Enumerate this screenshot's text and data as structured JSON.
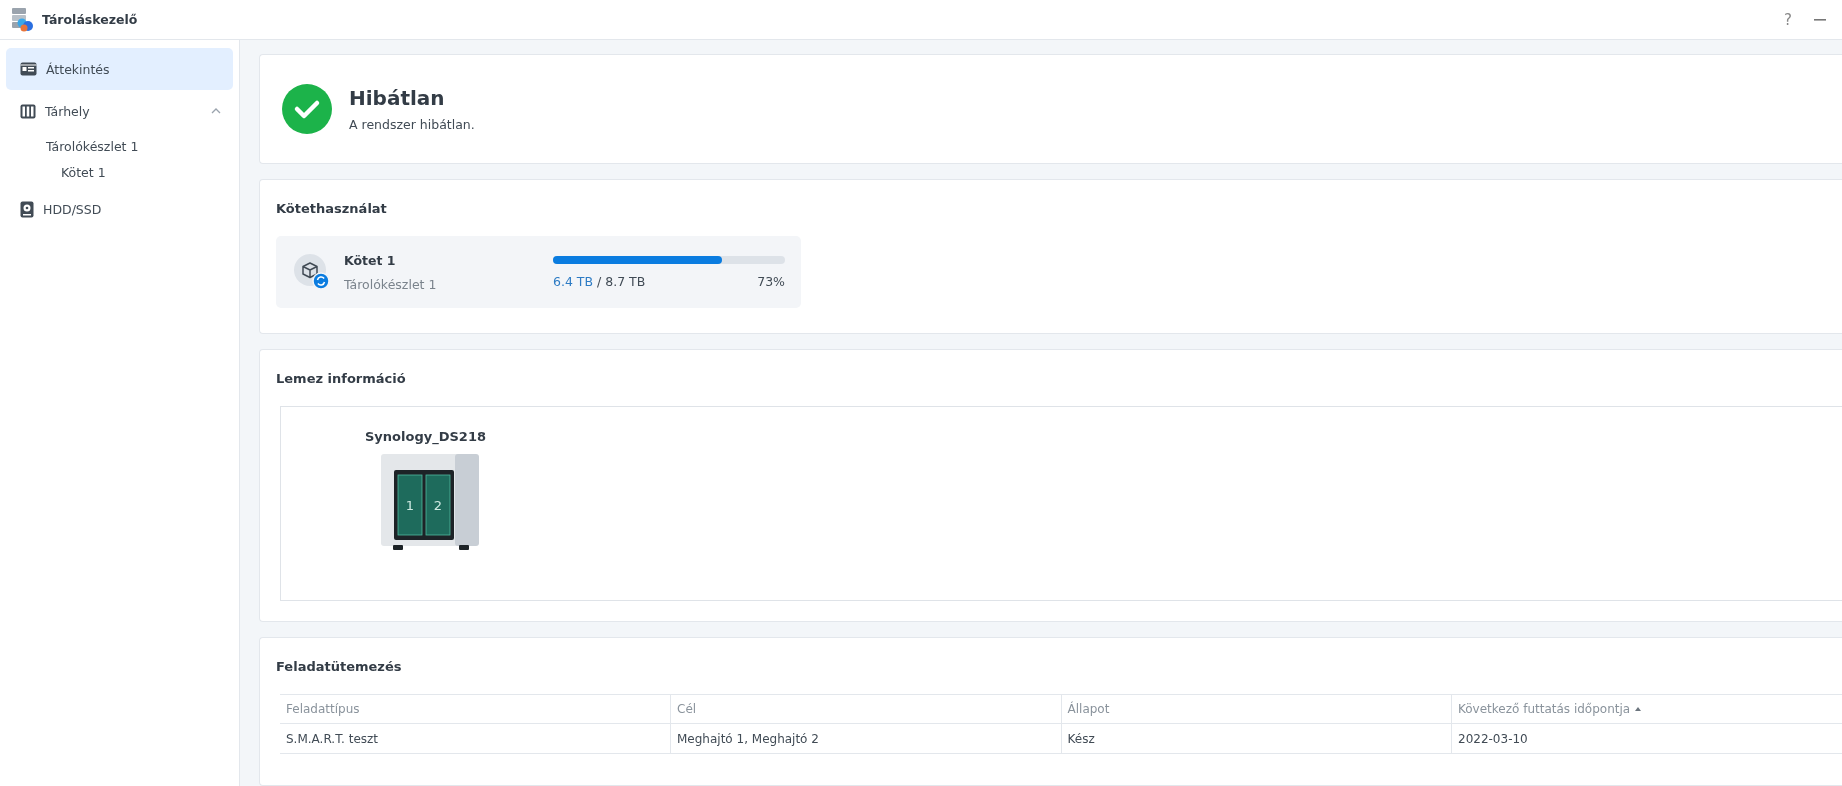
{
  "window": {
    "title": "Tároláskezelő",
    "help_label": "?"
  },
  "sidebar": {
    "items": [
      {
        "kind": "overview",
        "label": "Áttekintés",
        "selected": true
      },
      {
        "kind": "storage",
        "label": "Tárhely",
        "selected": false,
        "expanded": true,
        "children": [
          {
            "label": "Tárolókészlet 1",
            "selected": false,
            "children": [
              {
                "label": "Kötet 1",
                "selected": false
              }
            ]
          }
        ]
      },
      {
        "kind": "disk",
        "label": "HDD/SSD",
        "selected": false
      }
    ]
  },
  "status": {
    "kind": "healthy",
    "title": "Hibátlan",
    "message": "A rendszer hibátlan."
  },
  "volume_usage": {
    "title": "Kötethasználat",
    "volumes": [
      {
        "name": "Kötet 1",
        "pool": "Tárolókészlet 1",
        "used": "6.4 TB",
        "total": "/ 8.7 TB",
        "percent": "73%",
        "level": 0.73
      }
    ]
  },
  "disk_info": {
    "title": "Lemez információ",
    "device": {
      "name": "Synology_DS218",
      "bays": [
        {
          "label": "1"
        },
        {
          "label": "2"
        }
      ]
    }
  },
  "task_schedule": {
    "title": "Feladatütemezés",
    "table": {
      "columns": [
        {
          "label": "Feladattípus",
          "sorted": false
        },
        {
          "label": "Cél",
          "sorted": false
        },
        {
          "label": "Állapot",
          "sorted": false
        },
        {
          "label": "Következő futtatás időpontja",
          "sorted": true
        }
      ],
      "rows": [
        [
          "S.M.A.R.T. teszt",
          "Meghajtó 1, Meghajtó 2",
          "Kész",
          "2022-03-10"
        ]
      ]
    }
  }
}
